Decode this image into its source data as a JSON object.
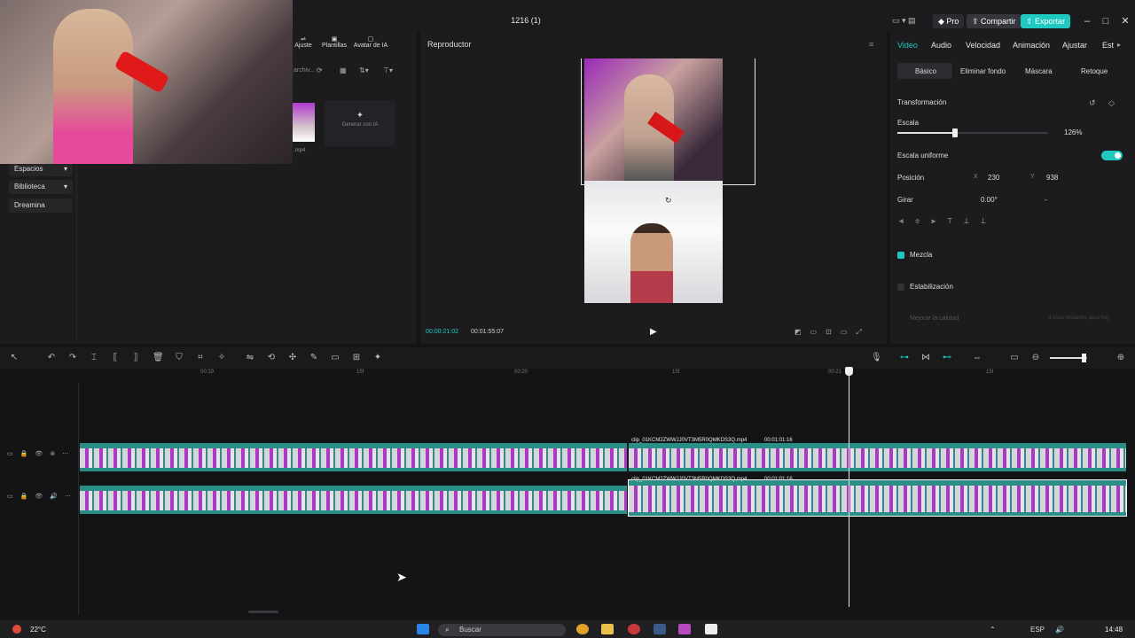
{
  "window": {
    "title": "1216 (1)",
    "pro_label": "Pro",
    "share_label": "Compartir",
    "export_label": "Exportar"
  },
  "left_panel": {
    "tools": [
      {
        "label": "Ajuste",
        "icon": "adjust-icon"
      },
      {
        "label": "Plantillas",
        "icon": "template-icon"
      },
      {
        "label": "Avatar de IA",
        "icon": "avatar-icon"
      }
    ],
    "search_partial": "archiv...",
    "nav_items": [
      "Espacios",
      "Biblioteca",
      "Dreamina"
    ],
    "media_file_label": ".mp4",
    "generate_label": "Generar con IA"
  },
  "player": {
    "title": "Reproductor",
    "current_time": "00:00:21:02",
    "total_time": "00:01:55:07"
  },
  "right_panel": {
    "tabs": [
      "Video",
      "Audio",
      "Velocidad",
      "Animación",
      "Ajustar",
      "Est"
    ],
    "active_tab": "Video",
    "subtabs": [
      "Básico",
      "Eliminar fondo",
      "Máscara",
      "Retoque"
    ],
    "transformacion": "Transformación",
    "escala_label": "Escala",
    "escala_value": "126%",
    "escala_fraction": 0.38,
    "escala_uniforme": "Escala uniforme",
    "posicion_label": "Posición",
    "pos_x_label": "X",
    "pos_x": "230",
    "pos_y_label": "Y",
    "pos_y": "938",
    "girar_label": "Girar",
    "girar_value": "0.00°",
    "girar_dash": "-",
    "mezcla": "Mezcla",
    "estabilizacion": "Estabilización",
    "mejorar": "Mejorar la calidad",
    "usos": "3 usos restantes para hoy",
    "accent": "#1fc8c0"
  },
  "timeline": {
    "ticks": [
      "00:19",
      "15f",
      "00:20",
      "15f",
      "00:21",
      "15f"
    ],
    "clip_label": "clip_01KCM2ZWWJJ0VT3M5R0QMKDS3Q.mp4",
    "clip_duration": "00:01:01:16",
    "zoom_fraction": 0.85
  },
  "taskbar": {
    "temperature": "22°C",
    "search_placeholder": "Buscar",
    "language": "ESP",
    "time": "14:48"
  }
}
